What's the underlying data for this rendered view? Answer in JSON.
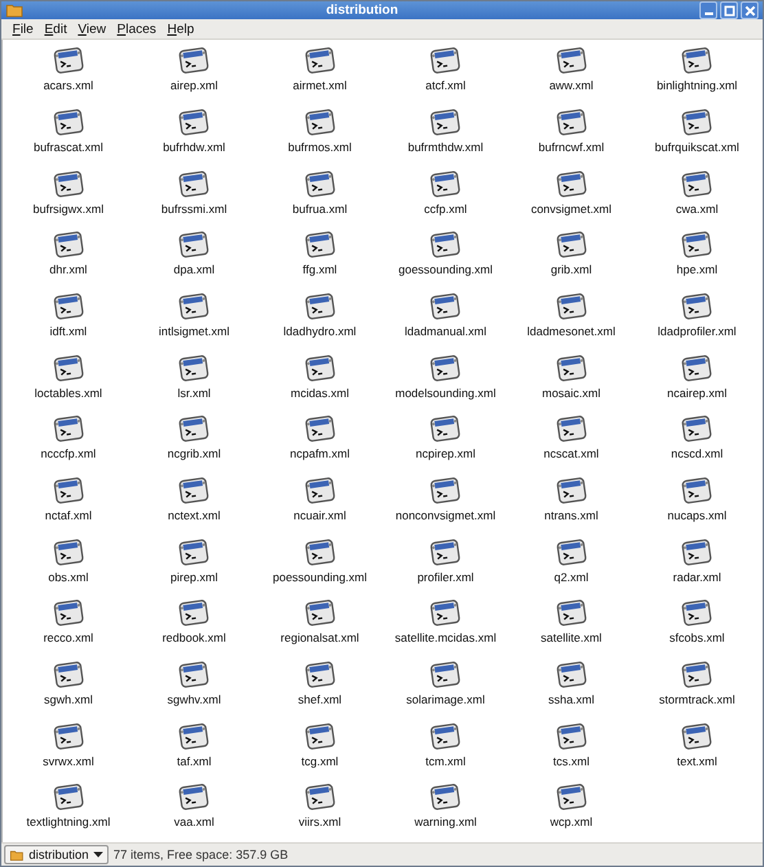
{
  "window": {
    "title": "distribution"
  },
  "menu": [
    "File",
    "Edit",
    "View",
    "Places",
    "Help"
  ],
  "files": [
    "acars.xml",
    "airep.xml",
    "airmet.xml",
    "atcf.xml",
    "aww.xml",
    "binlightning.xml",
    "bufrascat.xml",
    "bufrhdw.xml",
    "bufrmos.xml",
    "bufrmthdw.xml",
    "bufrncwf.xml",
    "bufrquikscat.xml",
    "bufrsigwx.xml",
    "bufrssmi.xml",
    "bufrua.xml",
    "ccfp.xml",
    "convsigmet.xml",
    "cwa.xml",
    "dhr.xml",
    "dpa.xml",
    "ffg.xml",
    "goessounding.xml",
    "grib.xml",
    "hpe.xml",
    "idft.xml",
    "intlsigmet.xml",
    "ldadhydro.xml",
    "ldadmanual.xml",
    "ldadmesonet.xml",
    "ldadprofiler.xml",
    "loctables.xml",
    "lsr.xml",
    "mcidas.xml",
    "modelsounding.xml",
    "mosaic.xml",
    "ncairep.xml",
    "ncccfp.xml",
    "ncgrib.xml",
    "ncpafm.xml",
    "ncpirep.xml",
    "ncscat.xml",
    "ncscd.xml",
    "nctaf.xml",
    "nctext.xml",
    "ncuair.xml",
    "nonconvsigmet.xml",
    "ntrans.xml",
    "nucaps.xml",
    "obs.xml",
    "pirep.xml",
    "poessounding.xml",
    "profiler.xml",
    "q2.xml",
    "radar.xml",
    "recco.xml",
    "redbook.xml",
    "regionalsat.xml",
    "satellite.mcidas.xml",
    "satellite.xml",
    "sfcobs.xml",
    "sgwh.xml",
    "sgwhv.xml",
    "shef.xml",
    "solarimage.xml",
    "ssha.xml",
    "stormtrack.xml",
    "svrwx.xml",
    "taf.xml",
    "tcg.xml",
    "tcm.xml",
    "tcs.xml",
    "text.xml",
    "textlightning.xml",
    "vaa.xml",
    "viirs.xml",
    "warning.xml",
    "wcp.xml"
  ],
  "status_bar": {
    "location": "distribution",
    "info": "77 items, Free space: 357.9 GB"
  }
}
